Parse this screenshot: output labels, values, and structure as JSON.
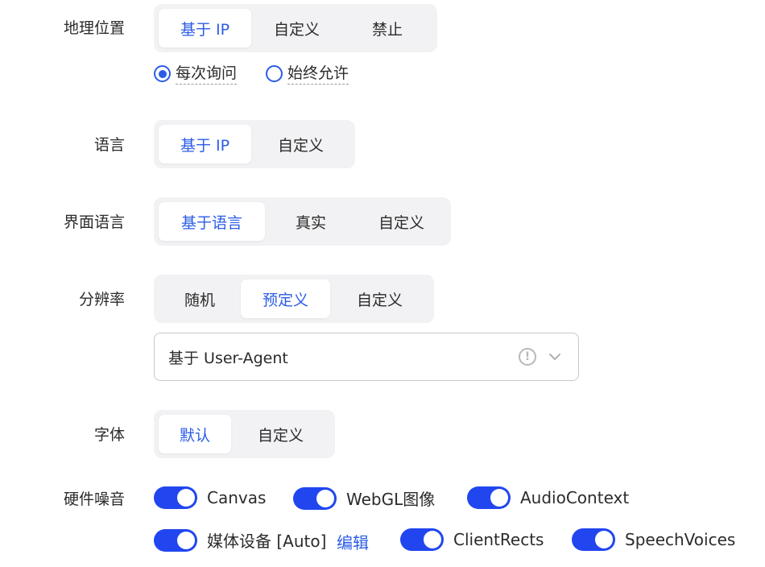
{
  "geolocation": {
    "label": "地理位置",
    "options": [
      "基于 IP",
      "自定义",
      "禁止"
    ],
    "selected": "基于 IP",
    "permission": {
      "options": [
        "每次询问",
        "始终允许"
      ],
      "selected": "每次询问"
    }
  },
  "language": {
    "label": "语言",
    "options": [
      "基于 IP",
      "自定义"
    ],
    "selected": "基于 IP"
  },
  "ui_language": {
    "label": "界面语言",
    "options": [
      "基于语言",
      "真实",
      "自定义"
    ],
    "selected": "基于语言"
  },
  "resolution": {
    "label": "分辨率",
    "options": [
      "随机",
      "预定义",
      "自定义"
    ],
    "selected": "预定义",
    "preset_select": {
      "value": "基于 User-Agent"
    }
  },
  "font": {
    "label": "字体",
    "options": [
      "默认",
      "自定义"
    ],
    "selected": "默认"
  },
  "hardware_noise": {
    "label": "硬件噪音",
    "toggles": [
      {
        "label": "Canvas",
        "on": true
      },
      {
        "label": "WebGL图像",
        "on": true
      },
      {
        "label": "AudioContext",
        "on": true
      },
      {
        "label": "媒体设备 [Auto]",
        "on": true
      },
      {
        "label": "ClientRects",
        "on": true
      },
      {
        "label": "SpeechVoices",
        "on": true
      }
    ],
    "edit_link": "编辑"
  },
  "colors": {
    "accent": "#2b5ce6",
    "switch_on": "#2146f0",
    "segment_bg": "#f2f2f4"
  }
}
